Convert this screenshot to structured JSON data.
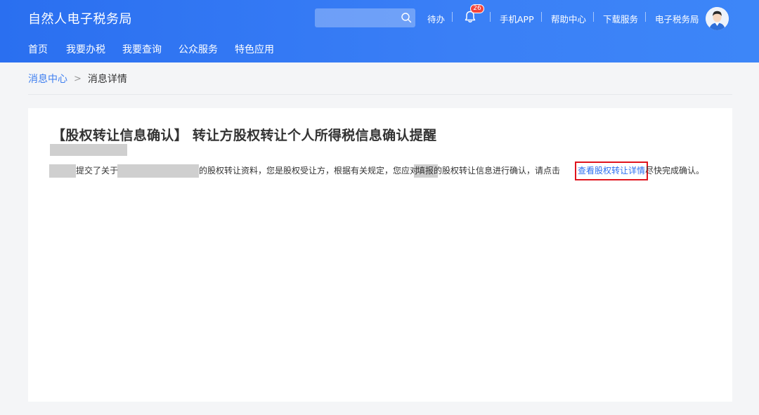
{
  "header": {
    "app_title": "自然人电子税务局",
    "search_placeholder": "",
    "todo_label": "待办",
    "notification_count": "26",
    "links": [
      "手机APP",
      "帮助中心",
      "下载服务",
      "电子税务局"
    ]
  },
  "nav": {
    "items": [
      "首页",
      "我要办税",
      "我要查询",
      "公众服务",
      "特色应用"
    ]
  },
  "breadcrumb": {
    "parent": "消息中心",
    "separator": ">",
    "current": "消息详情"
  },
  "message": {
    "title": "【股权转让信息确认】 转让方股权转让个人所得税信息确认提醒",
    "body_part1": "提交了关于",
    "body_part2": "的股权转让资料，您是股权受让方，根据有关规定，您应对",
    "body_part3": "填报的股权转让信息进行确认，请点击",
    "link_text": "查看股权转让详情",
    "body_part4": "尽快完成确认。"
  },
  "colors": {
    "header_blue": "#2f74f3",
    "link_blue": "#2b6ef0",
    "highlight_red": "#e0141e",
    "badge_red": "#f3443c"
  }
}
